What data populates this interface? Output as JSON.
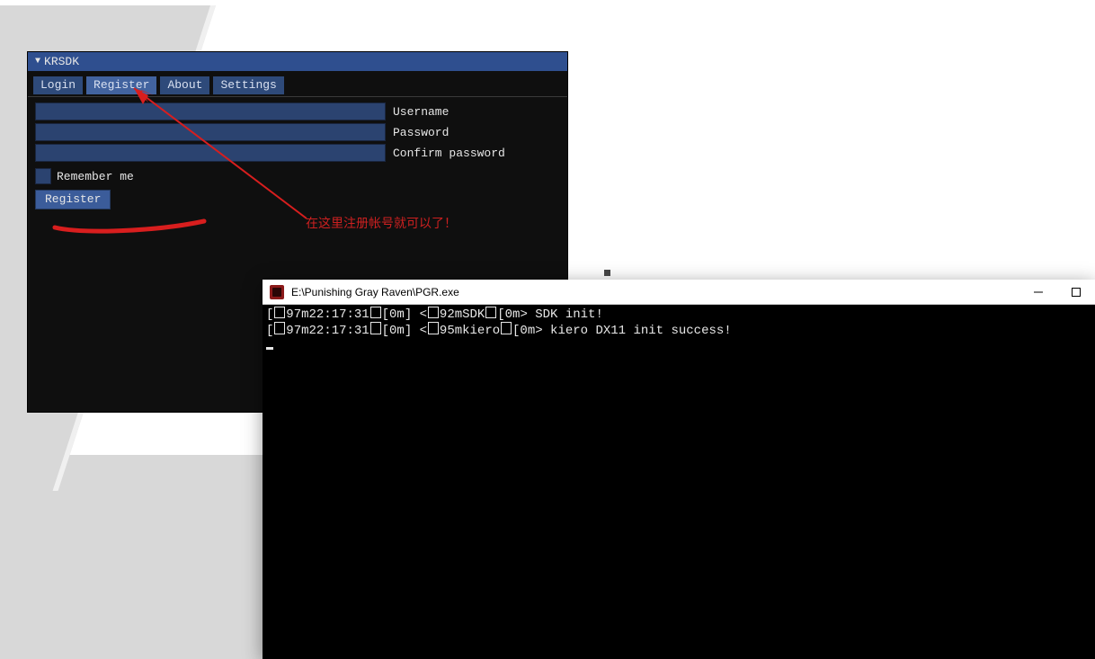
{
  "krsdk": {
    "title": "KRSDK",
    "tabs": {
      "login": "Login",
      "register": "Register",
      "about": "About",
      "settings": "Settings",
      "active": "register"
    },
    "fields": {
      "username": {
        "label": "Username",
        "value": ""
      },
      "password": {
        "label": "Password",
        "value": ""
      },
      "confirm": {
        "label": "Confirm password",
        "value": ""
      }
    },
    "remember": {
      "label": "Remember me",
      "checked": false
    },
    "submit_label": "Register"
  },
  "annotation": {
    "text": "在这里注册帐号就可以了！"
  },
  "console": {
    "title": "E:\\Punishing Gray Raven\\PGR.exe",
    "lines": [
      {
        "time": "97m22:17:31",
        "tag": "92mSDK",
        "msg": "SDK init!"
      },
      {
        "time": "97m22:17:31",
        "tag": "95mkiero",
        "msg": "kiero DX11 init success!"
      }
    ]
  }
}
